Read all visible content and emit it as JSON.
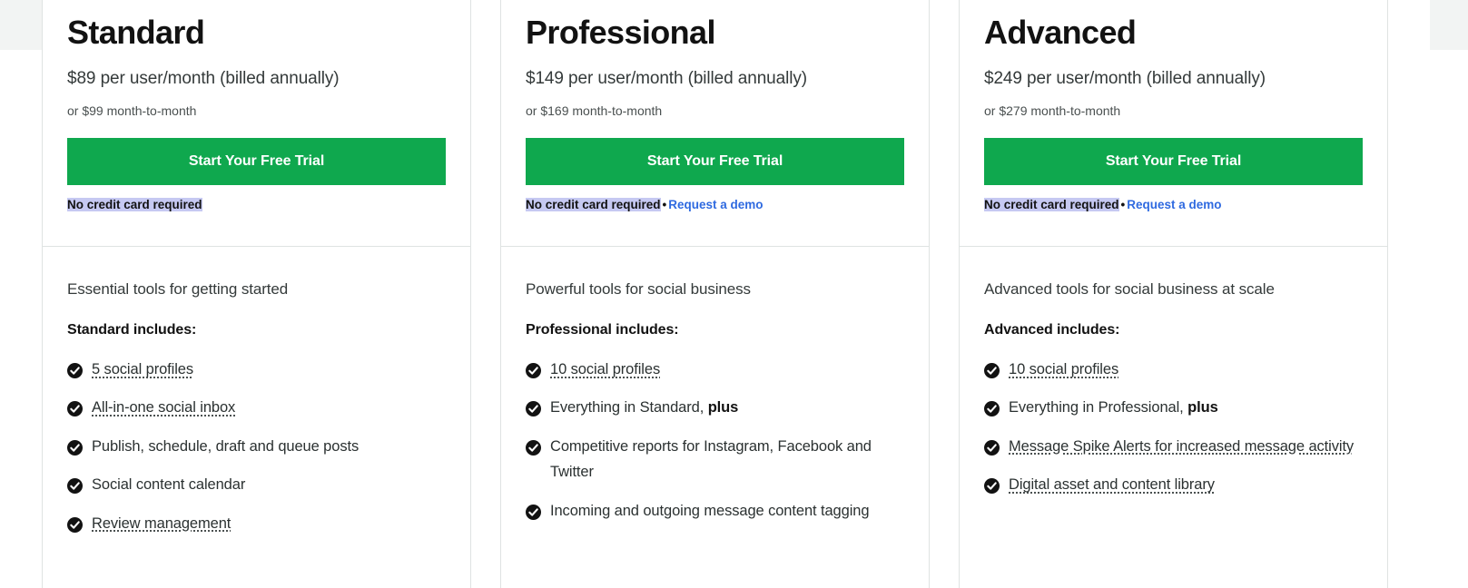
{
  "colors": {
    "cta_green": "#0fa84e",
    "link_blue": "#2f6ae0",
    "selection_highlight": "#c6c9f2",
    "page_band": "#f2f4f3",
    "card_border": "#dfe3e2",
    "check_circle": "#121212"
  },
  "plans": [
    {
      "name": "Standard",
      "price_line": "$89 per user/month (billed annually)",
      "price_sub": "or $99 month-to-month",
      "cta_label": "Start Your Free Trial",
      "no_card_note": "No credit card required",
      "separator": "•",
      "demo_link": "",
      "has_demo_link": false,
      "tagline": "Essential tools for getting started",
      "includes_heading": "Standard includes:",
      "features": [
        {
          "text": "5 social profiles",
          "tooltip": true,
          "bold_suffix": ""
        },
        {
          "text": "All-in-one social inbox",
          "tooltip": true,
          "bold_suffix": ""
        },
        {
          "text": "Publish, schedule, draft and queue posts",
          "tooltip": false,
          "bold_suffix": ""
        },
        {
          "text": "Social content calendar",
          "tooltip": false,
          "bold_suffix": ""
        },
        {
          "text": "Review management",
          "tooltip": true,
          "bold_suffix": ""
        }
      ]
    },
    {
      "name": "Professional",
      "price_line": "$149 per user/month (billed annually)",
      "price_sub": "or $169 month-to-month",
      "cta_label": "Start Your Free Trial",
      "no_card_note": "No credit card required",
      "separator": "•",
      "demo_link": "Request a demo",
      "has_demo_link": true,
      "tagline": "Powerful tools for social business",
      "includes_heading": "Professional includes:",
      "features": [
        {
          "text": "10 social profiles",
          "tooltip": true,
          "bold_suffix": ""
        },
        {
          "text": "Everything in Standard, ",
          "tooltip": false,
          "bold_suffix": "plus"
        },
        {
          "text": "Competitive reports for Instagram, Facebook and Twitter",
          "tooltip": false,
          "bold_suffix": ""
        },
        {
          "text": "Incoming and outgoing message content tagging",
          "tooltip": false,
          "bold_suffix": ""
        }
      ]
    },
    {
      "name": "Advanced",
      "price_line": "$249 per user/month (billed annually)",
      "price_sub": "or $279 month-to-month",
      "cta_label": "Start Your Free Trial",
      "no_card_note": "No credit card required",
      "separator": "•",
      "demo_link": "Request a demo",
      "has_demo_link": true,
      "tagline": "Advanced tools for social business at scale",
      "includes_heading": "Advanced includes:",
      "features": [
        {
          "text": "10 social profiles",
          "tooltip": true,
          "bold_suffix": ""
        },
        {
          "text": "Everything in Professional, ",
          "tooltip": false,
          "bold_suffix": "plus"
        },
        {
          "text": "Message Spike Alerts for increased message activity",
          "tooltip": true,
          "bold_suffix": ""
        },
        {
          "text": "Digital asset and content library",
          "tooltip": true,
          "bold_suffix": ""
        }
      ]
    }
  ]
}
